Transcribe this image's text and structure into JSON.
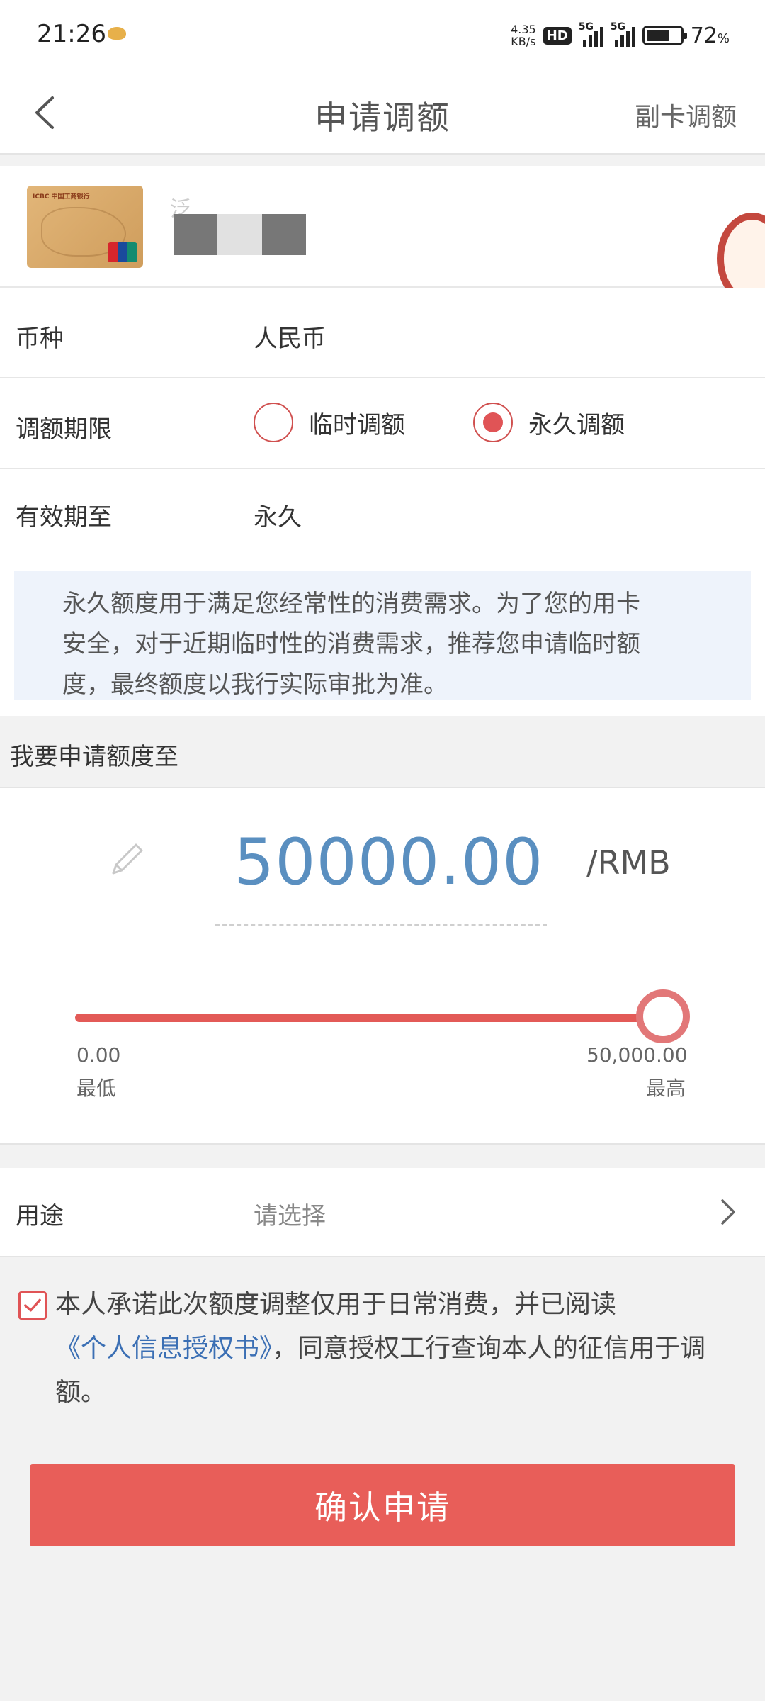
{
  "status_bar": {
    "time": "21:26",
    "net_speed_value": "4.35",
    "net_speed_unit": "KB/s",
    "hd_badge": "HD",
    "sim1": "5G",
    "sim2": "5G",
    "battery_percent": "72",
    "battery_unit": "%",
    "battery_level": 0.72
  },
  "nav": {
    "title": "申请调额",
    "right_action": "副卡调额"
  },
  "card": {
    "name_fragment": "泛"
  },
  "currency": {
    "label": "币种",
    "value": "人民币"
  },
  "limit_period": {
    "label": "调额期限",
    "options": [
      {
        "label": "临时调额",
        "selected": false
      },
      {
        "label": "永久调额",
        "selected": true
      }
    ]
  },
  "valid_until": {
    "label": "有效期至",
    "value": "永久"
  },
  "notice": {
    "lines": [
      "永久额度用于满足您经常性的消费需求。为了您的用卡",
      "安全，对于近期临时性的消费需求，推荐您申请临时额",
      "度，最终额度以我行实际审批为准。"
    ]
  },
  "amount_section": {
    "title": "我要申请额度至",
    "amount": "50000.00",
    "unit": "/RMB",
    "slider": {
      "min_value": "0.00",
      "min_label": "最低",
      "max_value": "50,000.00",
      "max_label": "最高",
      "level": 1.0
    }
  },
  "purpose": {
    "label": "用途",
    "placeholder": "请选择"
  },
  "agreement": {
    "checked": true,
    "text_before": "本人承诺此次额度调整仅用于日常消费，并已阅读",
    "link": "《个人信息授权书》",
    "text_after": "，同意授权工行查询本人的征信用于调额。"
  },
  "confirm_button": "确认申请",
  "colors": {
    "accent": "#e85e59",
    "amount_blue": "#5a8fc0",
    "link_blue": "#3b6fb4",
    "notice_bg": "#eef3fb"
  }
}
